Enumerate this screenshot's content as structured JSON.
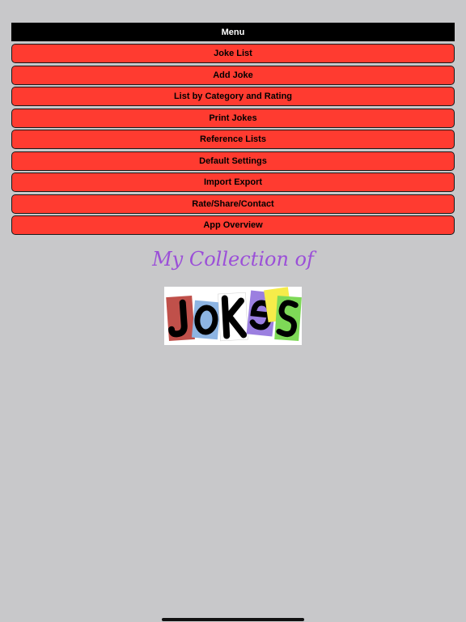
{
  "header": {
    "title": "Menu"
  },
  "menu": {
    "items": [
      {
        "label": "Joke List"
      },
      {
        "label": "Add Joke"
      },
      {
        "label": "List by Category and Rating"
      },
      {
        "label": "Print Jokes"
      },
      {
        "label": "Reference Lists"
      },
      {
        "label": "Default Settings"
      },
      {
        "label": "Import Export"
      },
      {
        "label": "Rate/Share/Contact"
      },
      {
        "label": "App Overview"
      }
    ]
  },
  "logo": {
    "title": "My Collection of",
    "image_text": "JOKES"
  },
  "colors": {
    "background": "#c8c8ca",
    "header_bg": "#000000",
    "button_bg": "#ff3b30",
    "title_purple": "#9b4fd8"
  }
}
